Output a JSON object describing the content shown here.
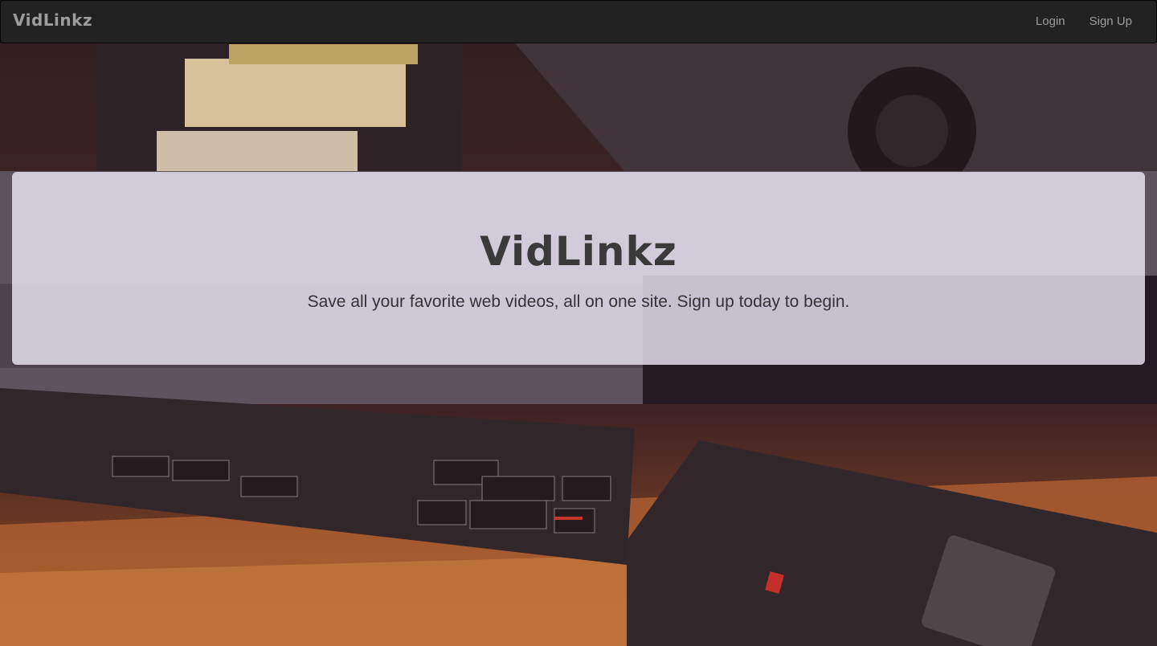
{
  "navbar": {
    "brand": "VidLinkz",
    "links": [
      {
        "label": "Login"
      },
      {
        "label": "Sign Up"
      }
    ]
  },
  "jumbotron": {
    "title": "VidLinkz",
    "subtitle": "Save all your favorite web videos, all on one site. Sign up today to begin."
  },
  "hero": {
    "image": "vhs-cassettes-and-vcr-remote-photo"
  },
  "colors": {
    "navbar_bg": "#222222",
    "nav_text": "#9d9d9d",
    "jumbotron_bg": "#ebe6f5",
    "title_text": "#3a3a3a"
  }
}
